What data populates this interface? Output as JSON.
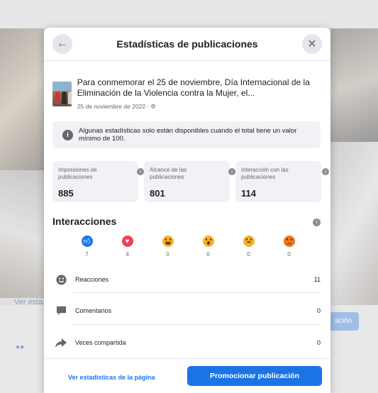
{
  "background": {
    "link_text": "Ver esta",
    "button_text": "ación"
  },
  "dialog": {
    "title": "Estadísticas de publicaciones",
    "back_icon": "arrow-left-icon",
    "close_icon": "close-icon"
  },
  "post": {
    "text": "Para conmemorar el 25 de noviembre, Día Internacional de la Eliminación de la Violencia contra la Mujer, el...",
    "date": "25 de noviembre de 2022 · ",
    "privacy_icon": "globe-icon"
  },
  "notice": {
    "text": "Algunas estadísticas solo están disponibles cuando el total tiene un valor mínimo de 100."
  },
  "stats": [
    {
      "label": "Impresiones de publicaciones",
      "value": "885"
    },
    {
      "label": "Alcance de las publicaciones",
      "value": "801"
    },
    {
      "label": "Interacción con las publicaciones",
      "value": "114"
    }
  ],
  "interactions": {
    "title": "Interacciones",
    "reactions": [
      {
        "name": "like",
        "count": "7"
      },
      {
        "name": "love",
        "count": "4"
      },
      {
        "name": "haha",
        "count": "0"
      },
      {
        "name": "wow",
        "count": "0"
      },
      {
        "name": "sad",
        "count": "0"
      },
      {
        "name": "angry",
        "count": "0"
      }
    ],
    "rows": [
      {
        "label": "Reacciones",
        "value": "11",
        "icon": "smiley-icon"
      },
      {
        "label": "Comentarios",
        "value": "0",
        "icon": "comment-icon"
      },
      {
        "label": "Veces compartida",
        "value": "0",
        "icon": "share-icon"
      }
    ]
  },
  "footer": {
    "page_stats_link": "Ver estadísticas de la página",
    "promote_button": "Promocionar publicación"
  },
  "colors": {
    "accent": "#1b74e4",
    "like": "#1877f2",
    "love": "#f33e58",
    "emoji": "#f7b125"
  }
}
